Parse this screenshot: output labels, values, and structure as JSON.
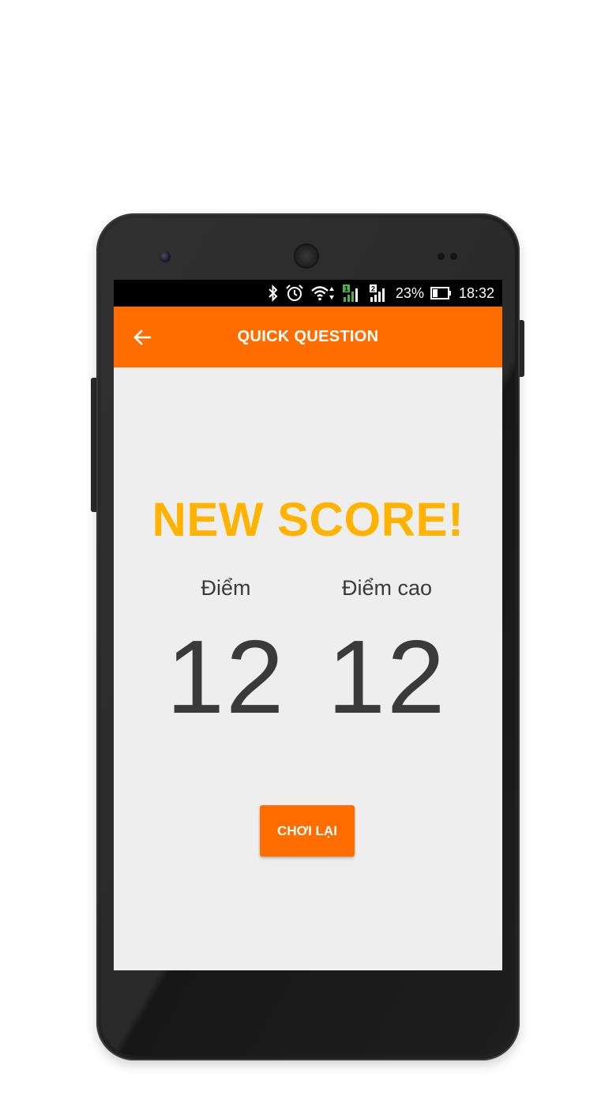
{
  "status_bar": {
    "icons": [
      "bluetooth-icon",
      "alarm-icon",
      "wifi-icon",
      "signal-sim1-icon",
      "signal-sim2-icon",
      "battery-icon"
    ],
    "battery_percent": "23%",
    "time": "18:32"
  },
  "app_bar": {
    "back_icon": "arrow-left-icon",
    "title": "QUICK QUESTION"
  },
  "result": {
    "headline": "NEW SCORE!",
    "score_label": "Điểm",
    "score_value": "12",
    "high_score_label": "Điểm cao",
    "high_score_value": "12",
    "replay_button": "CHƠI LẠI"
  },
  "colors": {
    "accent": "#ff6d00",
    "headline": "#ffb300",
    "background": "#eeeeee",
    "text": "#3a3a3a"
  }
}
